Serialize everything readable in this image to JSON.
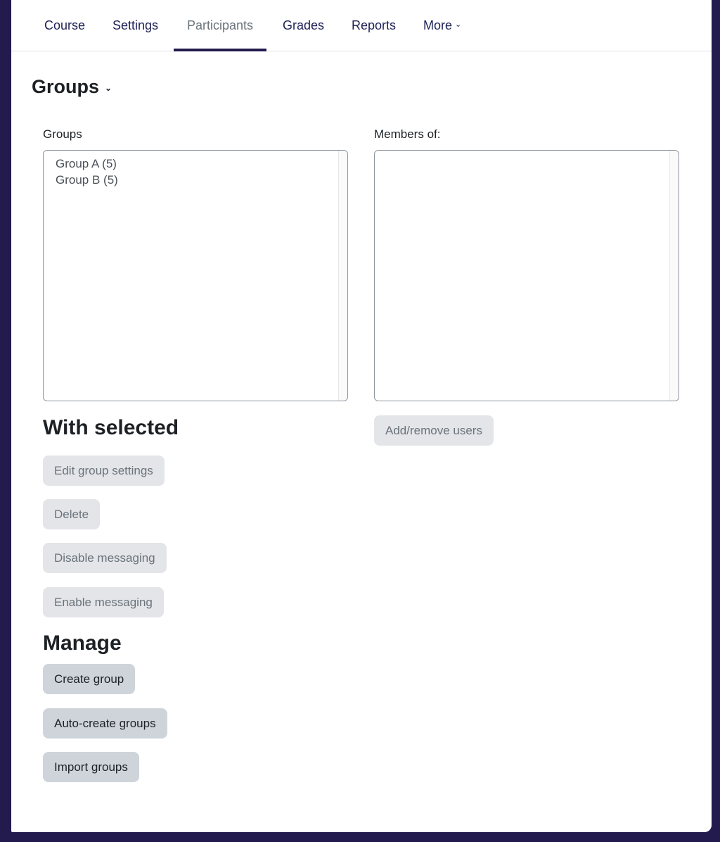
{
  "nav": {
    "tabs": [
      {
        "label": "Course",
        "active": false
      },
      {
        "label": "Settings",
        "active": false
      },
      {
        "label": "Participants",
        "active": true
      },
      {
        "label": "Grades",
        "active": false
      },
      {
        "label": "Reports",
        "active": false
      },
      {
        "label": "More",
        "active": false,
        "has_dropdown": true
      }
    ]
  },
  "page": {
    "title": "Groups",
    "title_icon": "chevron-down-icon"
  },
  "groups_panel": {
    "label": "Groups",
    "options": [
      "Group A (5)",
      "Group B (5)"
    ]
  },
  "members_panel": {
    "label": "Members of:",
    "options": [],
    "add_remove_button": "Add/remove users"
  },
  "with_selected": {
    "heading": "With selected",
    "buttons": [
      "Edit group settings",
      "Delete",
      "Disable messaging",
      "Enable messaging"
    ]
  },
  "manage": {
    "heading": "Manage",
    "buttons": [
      "Create group",
      "Auto-create groups",
      "Import groups"
    ]
  },
  "colors": {
    "brand": "#231a4e",
    "nav_text": "#1d2055",
    "disabled_button_bg": "#e3e5e8",
    "button_bg": "#ced4da"
  }
}
